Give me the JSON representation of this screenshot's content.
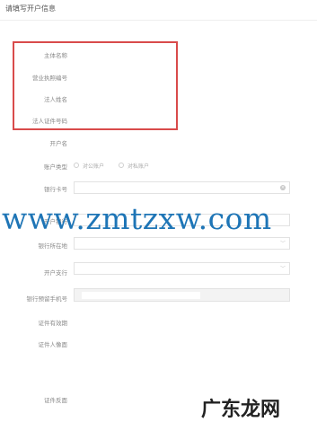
{
  "header": {
    "title": "请填写开户信息"
  },
  "highlighted_fields": [
    {
      "label": "主体名称"
    },
    {
      "label": "营业执照编号"
    },
    {
      "label": "法人姓名"
    },
    {
      "label": "法人证件号码"
    }
  ],
  "form": {
    "account_name_label": "开户名",
    "account_type_label": "账户类型",
    "account_type_options": [
      "对公账户",
      "对私账户"
    ],
    "bank_card_label": "银行卡号",
    "bank_card_clear_icon": "×",
    "bank_label": "开户银行",
    "bank_location_label": "银行所在地",
    "branch_label": "开户支行",
    "phone_label": "银行预留手机号",
    "id_validity_label": "证件有效期",
    "id_portrait_label": "证件人像面",
    "id_back_label": "证件反面",
    "dropdown_chevron": "﹀"
  },
  "watermark": {
    "text": "www.zmtzxw.com",
    "corner_text": "广东龙网"
  },
  "colors": {
    "highlight_border": "#d94b4b",
    "watermark": "#1e75b6"
  }
}
